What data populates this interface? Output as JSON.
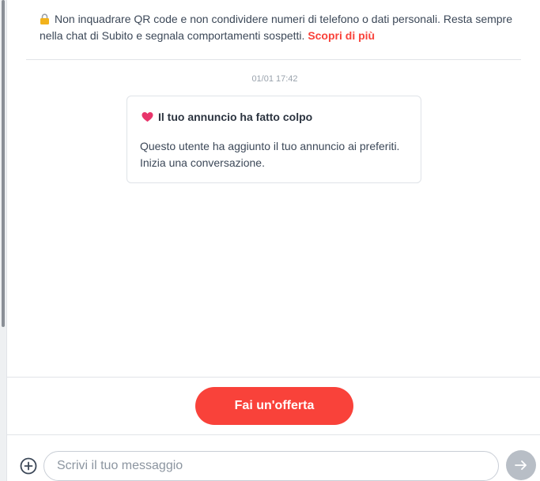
{
  "notice": {
    "icon": "lock-icon",
    "text": "Non inquadrare QR code e non condividere numeri di telefono o dati personali. Resta sempre nella chat di Subito e segnala comportamenti sospetti.",
    "link_label": "Scopri di più"
  },
  "chat": {
    "timestamp": "01/01 17:42",
    "card": {
      "icon": "heart-icon",
      "title": "Il tuo annuncio ha fatto colpo",
      "body": "Questo utente ha aggiunto il tuo annuncio ai preferiti. Inizia una conversazione."
    }
  },
  "actions": {
    "offer_label": "Fai un'offerta"
  },
  "composer": {
    "placeholder": "Scrivi il tuo messaggio",
    "value": "",
    "attach_icon": "plus-circle-icon",
    "send_icon": "arrow-right-icon"
  },
  "colors": {
    "accent": "#f9423a",
    "send_disabled": "#b8bec6"
  }
}
